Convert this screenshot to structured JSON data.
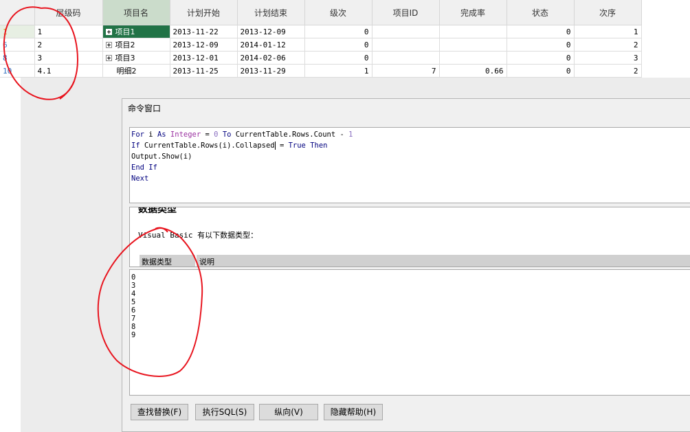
{
  "grid": {
    "columns": [
      "层级码",
      "项目名",
      "计划开始",
      "计划结束",
      "级次",
      "项目ID",
      "完成率",
      "状态",
      "次序"
    ],
    "rows": [
      {
        "num": "1",
        "code": "1",
        "name": "项目1",
        "start": "2013-11-22",
        "end": "2013-12-09",
        "level": "0",
        "pid": "",
        "rate": "",
        "status": "0",
        "order": "1"
      },
      {
        "num": "6",
        "code": "2",
        "name": "项目2",
        "start": "2013-12-09",
        "end": "2014-01-12",
        "level": "0",
        "pid": "",
        "rate": "",
        "status": "0",
        "order": "2"
      },
      {
        "num": "8",
        "code": "3",
        "name": "项目3",
        "start": "2013-12-01",
        "end": "2014-02-06",
        "level": "0",
        "pid": "",
        "rate": "",
        "status": "0",
        "order": "3"
      },
      {
        "num": "10",
        "code": "4.1",
        "name": "明细2",
        "start": "2013-11-25",
        "end": "2013-11-29",
        "level": "1",
        "pid": "7",
        "rate": "0.66",
        "status": "0",
        "order": "2"
      }
    ]
  },
  "cmd": {
    "title": "命令窗口",
    "code": {
      "l1": {
        "k1": "For",
        "v1": " i ",
        "k2": "As",
        "ty": "Integer",
        "t1": " = ",
        "n0": "0",
        "t2": " ",
        "k3": "To",
        "t3": " CurrentTable.Rows.Count - ",
        "n1": "1"
      },
      "l2": {
        "k1": "If",
        "t1": " CurrentTable.Rows(i).Collapsed",
        "t2": " = ",
        "k2": "True",
        "t3": " ",
        "k3": "Then"
      },
      "l3": "Output.Show(i)",
      "l4": {
        "k1": "End",
        "t1": " ",
        "k2": "If"
      },
      "l5": "Next"
    },
    "help": {
      "title": "数据类型",
      "line": "Visual Basic 有以下数据类型：",
      "col1": "数据类型",
      "col2": "说明"
    },
    "output": [
      "0",
      "3",
      "4",
      "5",
      "6",
      "7",
      "8",
      "9"
    ],
    "buttons": [
      "查找替换(F)",
      "执行SQL(S)",
      "纵向(V)",
      "隐藏帮助(H)"
    ]
  }
}
